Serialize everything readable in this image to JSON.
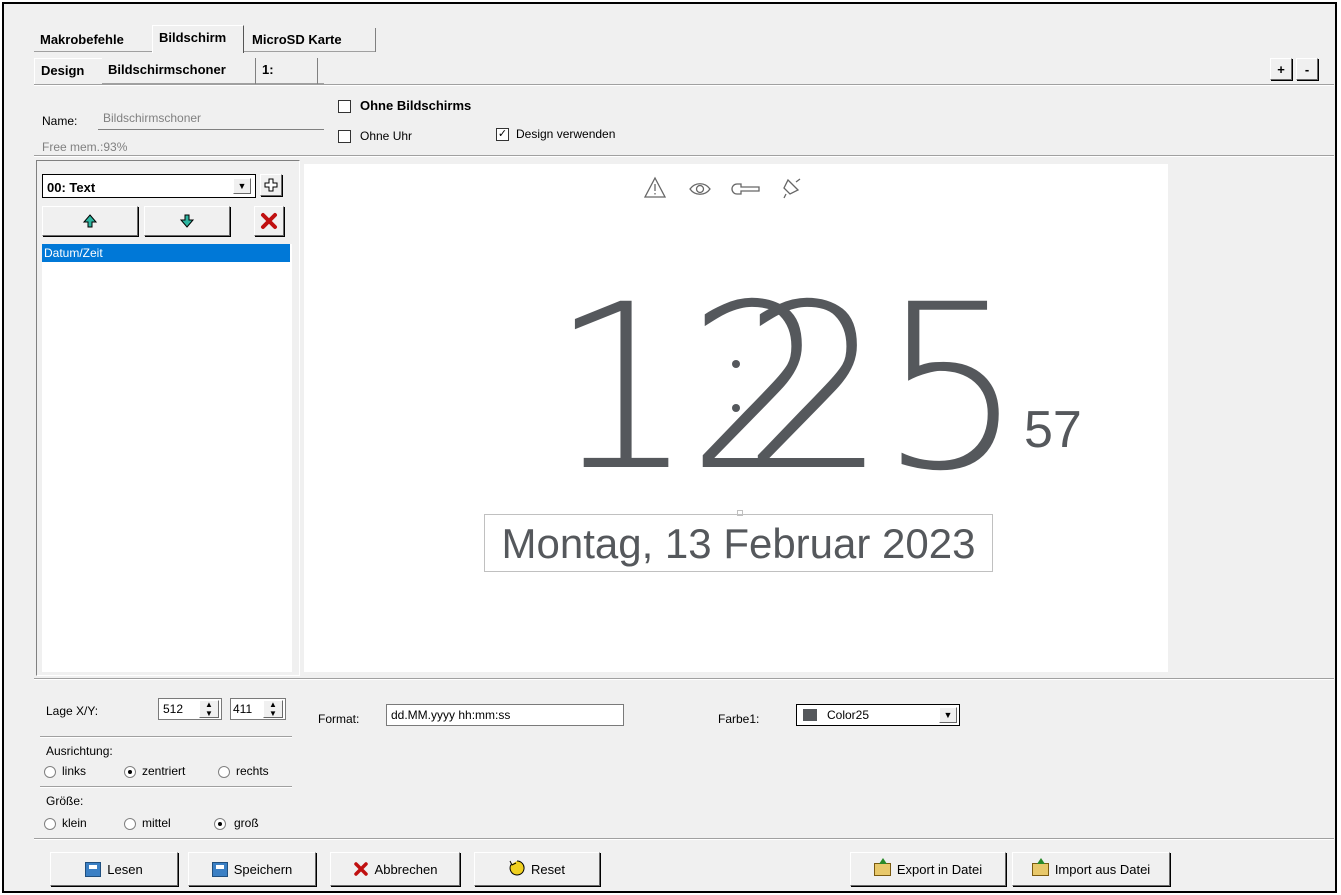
{
  "tabs_top": [
    "Makrobefehle",
    "Bildschirm",
    "MicroSD Karte"
  ],
  "tabs_sub": [
    "Design",
    "Bildschirmschoner",
    "1:"
  ],
  "plus_label": "+",
  "minus_label": "-",
  "name_label": "Name:",
  "name_value": "Bildschirmschoner",
  "free_mem": "Free mem.:93%",
  "ohne_bildschirms": "Ohne Bildschirms",
  "ohne_uhr": "Ohne Uhr",
  "design_verwenden": "Design verwenden",
  "element_select": "00: Text",
  "list_items": [
    "Datum/Zeit"
  ],
  "preview": {
    "hours": "12",
    "minutes": "25",
    "seconds": "57",
    "date": "Montag, 13 Februar 2023",
    "text_color": "#55585c"
  },
  "lage_label": "Lage X/Y:",
  "lage_x": "512",
  "lage_y": "411",
  "format_label": "Format:",
  "format_value": "dd.MM.yyyy hh:mm:ss",
  "farbe_label": "Farbe1:",
  "farbe_value": "Color25",
  "farbe_swatch": "#55585c",
  "ausrichtung_label": "Ausrichtung:",
  "ausrichtung_options": [
    "links",
    "zentriert",
    "rechts"
  ],
  "groesse_label": "Größe:",
  "groesse_options": [
    "klein",
    "mittel",
    "groß"
  ],
  "buttons": {
    "lesen": "Lesen",
    "speichern": "Speichern",
    "abbrechen": "Abbrechen",
    "reset": "Reset",
    "export": "Export in Datei",
    "import": "Import aus Datei"
  }
}
